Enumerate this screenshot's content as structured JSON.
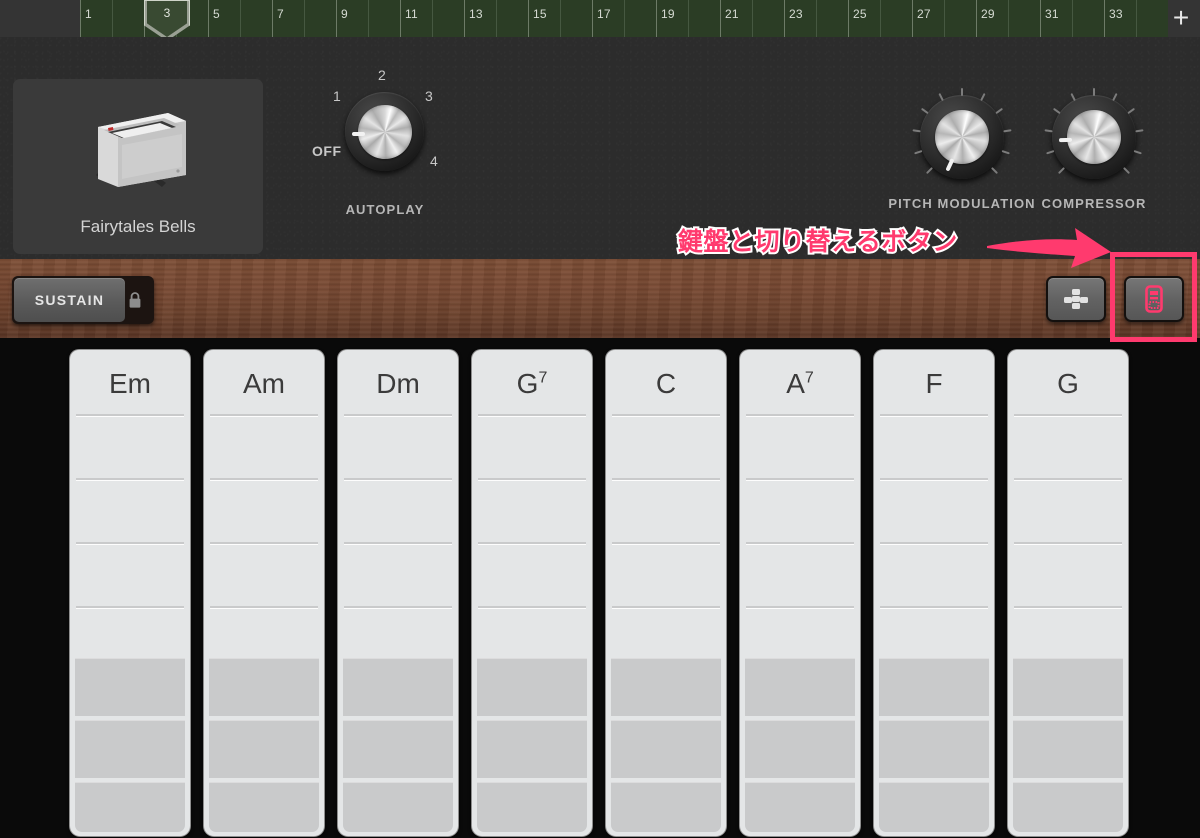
{
  "ruler": {
    "name": "timeline-ruler",
    "bar_numbers": [
      1,
      3,
      5,
      7,
      9,
      11,
      13,
      15,
      17,
      19,
      21,
      23,
      25,
      27,
      29,
      31,
      33
    ],
    "playhead_bar": "3",
    "add_button_label": "+",
    "green_color": "#2b3d25"
  },
  "instrument": {
    "name": "Fairytales Bells",
    "icon": "celesta-instrument-icon"
  },
  "autoplay": {
    "label": "AUTOPLAY",
    "scale": [
      "OFF",
      "1",
      "2",
      "3",
      "4"
    ],
    "value": "OFF",
    "angle_deg": 180
  },
  "knobs": [
    {
      "label": "PITCH MODULATION",
      "icon": "knob-icon",
      "angle_deg": 115
    },
    {
      "label": "COMPRESSOR",
      "icon": "knob-icon",
      "angle_deg": 178
    }
  ],
  "annotation": {
    "text": "鍵盤と切り替えるボタン",
    "arrow": "arrow-right-icon",
    "highlight": "highlight-rectangle",
    "color": "#ff3a6e"
  },
  "toolbar": {
    "sustain_label": "SUSTAIN",
    "lock_icon": "lock-icon",
    "chords_button_icon": "chord-dots-icon",
    "keyboard_button_icon": "keyboard-icon"
  },
  "chords": {
    "strips": [
      {
        "root": "Em",
        "ext": ""
      },
      {
        "root": "Am",
        "ext": ""
      },
      {
        "root": "Dm",
        "ext": ""
      },
      {
        "root": "G",
        "ext": "7"
      },
      {
        "root": "C",
        "ext": ""
      },
      {
        "root": "A",
        "ext": "7"
      },
      {
        "root": "F",
        "ext": ""
      },
      {
        "root": "G",
        "ext": ""
      }
    ],
    "light_color": "#e4e6e7",
    "dark_color": "#c9cacb"
  }
}
